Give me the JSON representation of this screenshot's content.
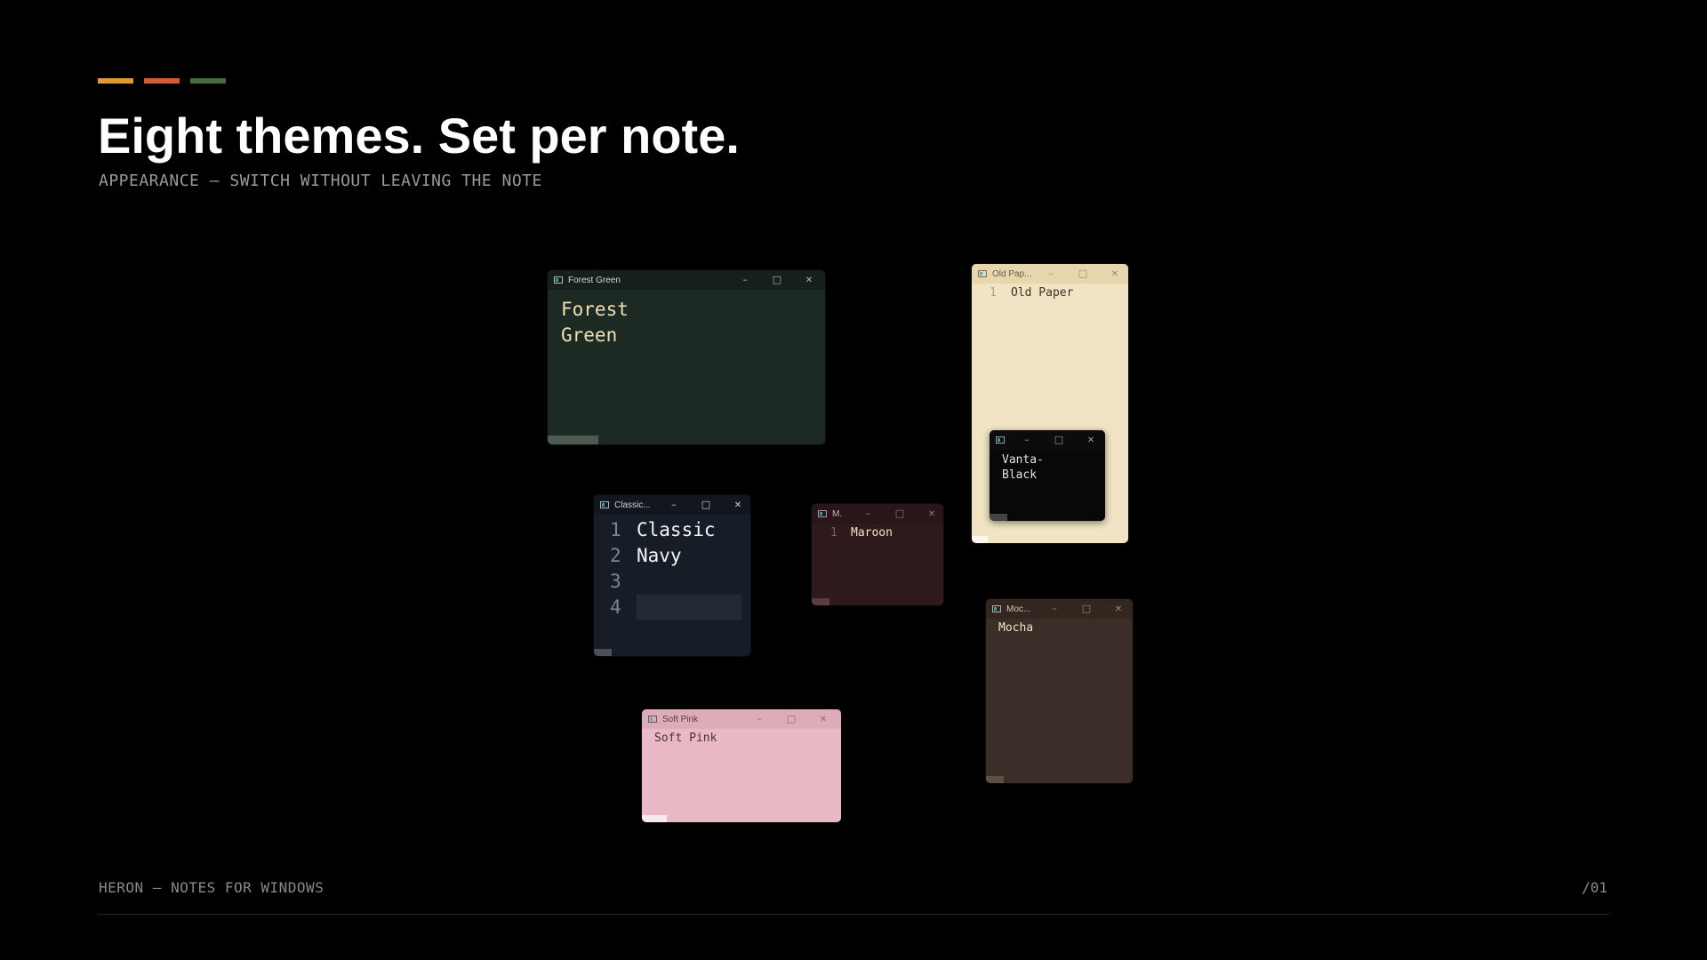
{
  "header": {
    "accent_colors": [
      "#e09a30",
      "#d65a32",
      "#4a6a3a"
    ],
    "title": "Eight themes. Set per note.",
    "subtitle": "APPEARANCE — SWITCH WITHOUT LEAVING THE NOTE"
  },
  "footer": {
    "left": "HERON — NOTES FOR WINDOWS",
    "right": "/01"
  },
  "windows": {
    "forest_green": {
      "title": "Forest Green",
      "content": "Forest\nGreen",
      "bg": "#1d2a24"
    },
    "old_paper": {
      "title": "Old Pap...",
      "line_number": "1",
      "content": "Old Paper",
      "bg": "#f1e4c4"
    },
    "vanta_black": {
      "content": "Vanta-\nBlack",
      "bg": "#080808"
    },
    "classic_navy": {
      "title": "Classic...",
      "line_numbers": "1\n2\n3\n4",
      "content": "Classic\nNavy",
      "bg": "#171d27"
    },
    "maroon": {
      "title": "M.",
      "line_number": "1",
      "content": "Maroon",
      "bg": "#2e1a1c"
    },
    "mocha": {
      "title": "Moc...",
      "content": "Mocha",
      "bg": "#3b2d27"
    },
    "soft_pink": {
      "title": "Soft Pink",
      "content": "Soft Pink",
      "bg": "#e9b9c5"
    }
  },
  "icons": {
    "app": "note-app-icon",
    "minimize": "minimize-icon",
    "maximize": "maximize-icon",
    "close": "close-icon"
  }
}
